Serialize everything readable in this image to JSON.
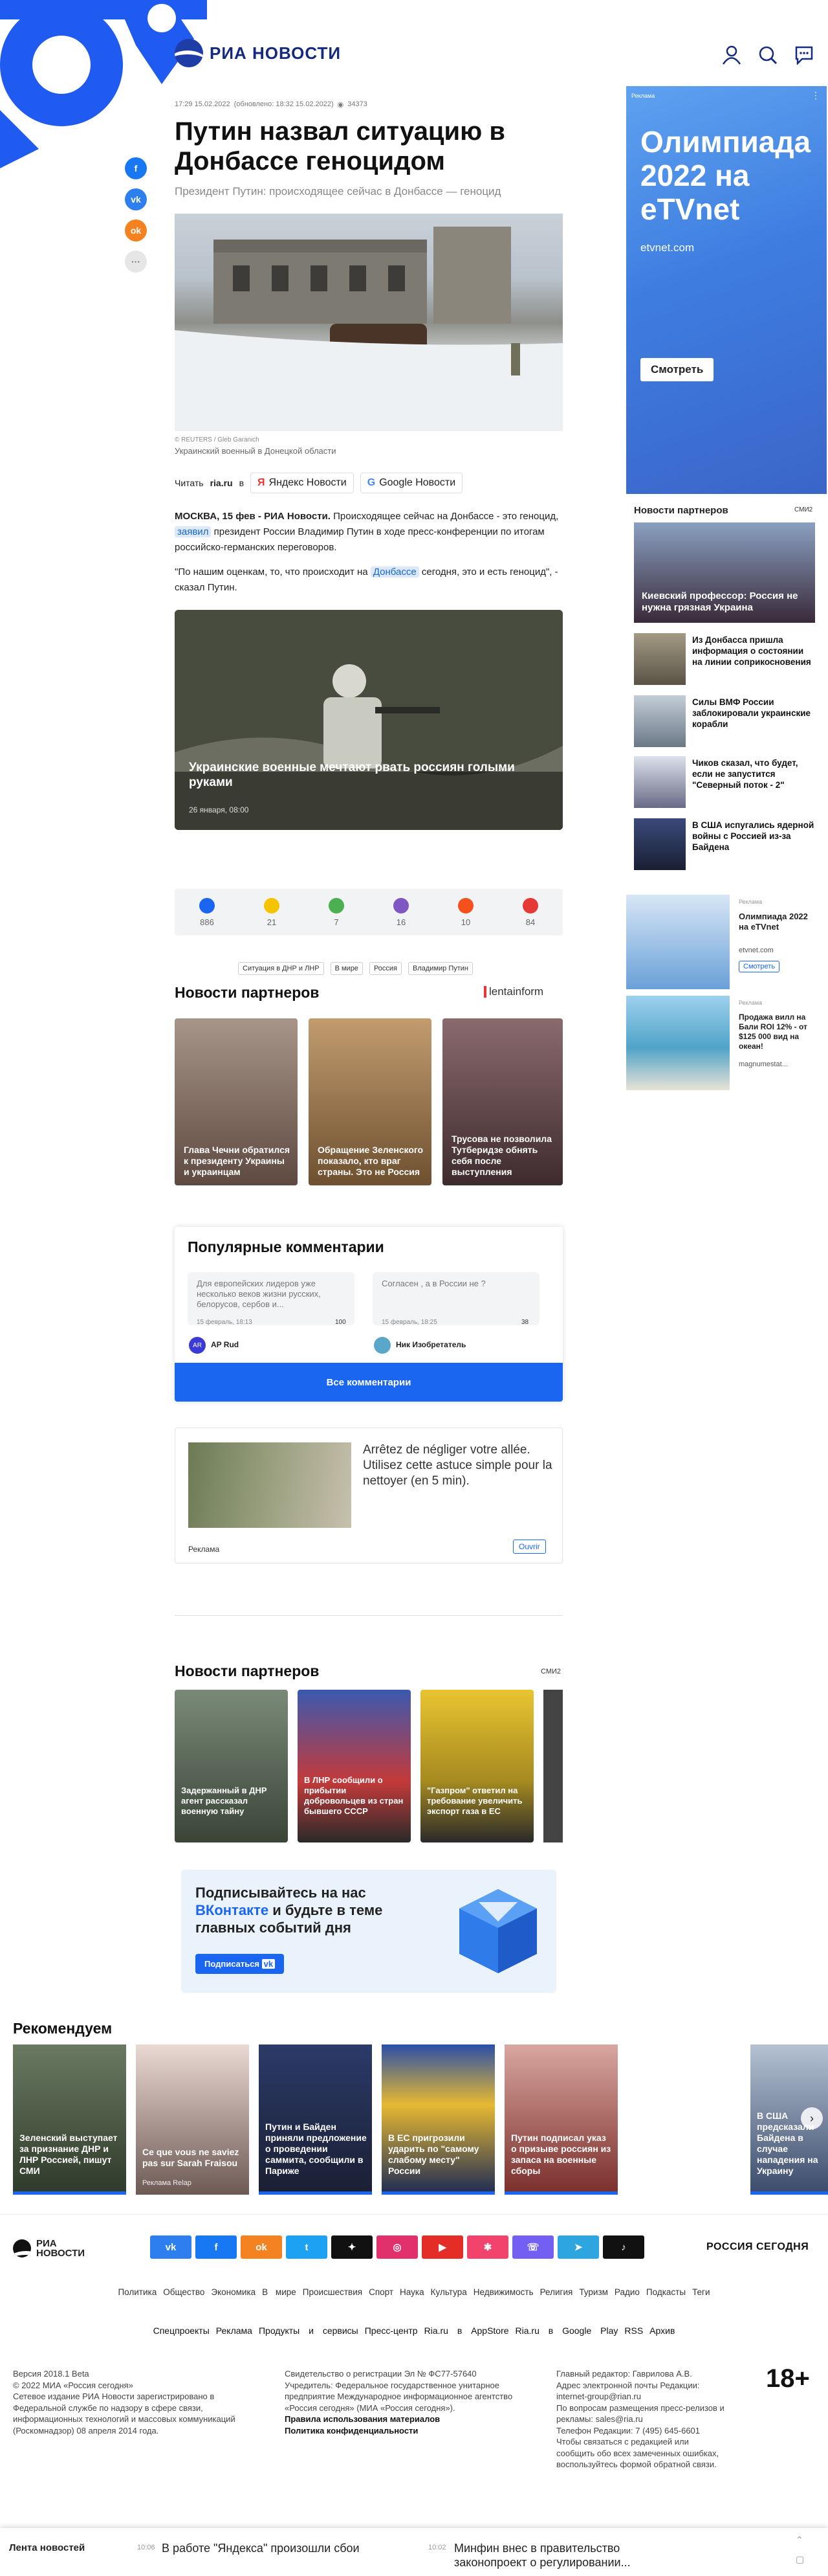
{
  "header": {
    "logo_text": "РИА НОВОСТИ"
  },
  "article": {
    "timestamp": "17:29 15.02.2022",
    "updated": "(обновлено: 18:32 15.02.2022)",
    "views": "34373",
    "title": "Путин назвал ситуацию в Донбассе геноцидом",
    "lead": "Президент Путин: происходящее сейчас в Донбассе — геноцид",
    "photo_credit": "© REUTERS / Gleb Garanich",
    "photo_caption": "Украинский военный в Донецкой области",
    "read_label": "Читать",
    "read_site": "ria.ru",
    "read_in": "в",
    "yandex_label": "Яндекс Новости",
    "google_label": "Google Новости",
    "p1_bold": "МОСКВА, 15 фев - РИА Новости.",
    "p1_a": "Происходящее сейчас на Донбассе - это геноцид,",
    "p1_link": "заявил",
    "p1_b": "президент России Владимир Путин в ходе пресс-конференции по итогам российско-германских переговоров.",
    "p2_a": "\"По нашим оценкам, то, что происходит на",
    "p2_link": "Донбассе",
    "p2_b": "сегодня, это и есть геноцид\", - сказал Путин."
  },
  "promo": {
    "title": "Украинские военные мечтают рвать россиян голыми руками",
    "date": "26 января, 08:00"
  },
  "reactions": [
    {
      "count": "886",
      "color": "#1a66f0"
    },
    {
      "count": "21",
      "color": "#f5c400"
    },
    {
      "count": "7",
      "color": "#4caf50"
    },
    {
      "count": "16",
      "color": "#7e57c2"
    },
    {
      "count": "10",
      "color": "#f4511e"
    },
    {
      "count": "84",
      "color": "#e53935"
    }
  ],
  "tags": [
    "Ситуация в ДНР и ЛНР",
    "В мире",
    "Россия",
    "Владимир Путин"
  ],
  "partners1": {
    "title": "Новости партнеров",
    "brand": "lentainform",
    "items": [
      {
        "title": "Глава Чечни обратился к президенту Украины и украинцам"
      },
      {
        "title": "Обращение Зеленского показало, кто враг страны. Это не Россия"
      },
      {
        "title": "Трусова не позволила Тутберидзе обнять себя после выступления"
      }
    ]
  },
  "comments": {
    "title": "Популярные комментарии",
    "items": [
      {
        "text": "Для европейских лидеров уже несколько веков жизни русских, белорусов, сербов и...",
        "date": "15 февраль, 18:13",
        "likes": "100",
        "user": "AP Rud"
      },
      {
        "text": "Согласен , а в России не ?",
        "date": "15 февраль, 18:25",
        "likes": "38",
        "user": "Ник Изобретатель"
      }
    ],
    "all_label": "Все комментарии"
  },
  "ad1": {
    "text": "Arrêtez de négliger votre allée. Utilisez cette astuce simple pour la nettoyer (en 5 min).",
    "label": "Реклама",
    "button": "Ouvrir"
  },
  "partners2": {
    "title": "Новости партнеров",
    "brand": "СМИ2",
    "items": [
      {
        "title": "Задержанный в ДНР агент рассказал военную тайну"
      },
      {
        "title": "В ЛНР сообщили о прибытии добровольцев из стран бывшего СССР"
      },
      {
        "title": "\"Газпром\" ответил на требование увеличить экспорт газа в ЕС"
      }
    ]
  },
  "subscribe": {
    "line1": "Подписывайтесь на нас",
    "vk": "ВКонтакте",
    "line2": "и будьте в теме главных событий дня",
    "button": "Подписаться"
  },
  "recommend": {
    "title": "Рекомендуем",
    "items": [
      {
        "title": "Зеленский выступает за признание ДНР и ЛНР Россией, пишут СМИ"
      },
      {
        "title": "Ce que vous ne saviez pas sur Sarah Fraisou",
        "sub": "Реклама Relap"
      },
      {
        "title": "Путин и Байден приняли предложение о проведении саммита, сообщили в Париже"
      },
      {
        "title": "В ЕС пригрозили ударить по \"самому слабому месту\" России"
      },
      {
        "title": "Путин подписал указ о призыве россиян из запаса на военные сборы"
      },
      {
        "title": "В США предсказали Байдена в случае нападения на Украину"
      }
    ]
  },
  "sidebar": {
    "ad": {
      "tag": "Реклама",
      "title": "Олимпиада 2022 на eTVnet",
      "url": "etvnet.com",
      "button": "Смотреть"
    },
    "partners_title": "Новости партнеров",
    "partners_brand": "СМИ2",
    "partners_top": "Киевский профессор: Россия не нужна грязная Украина",
    "partners": [
      {
        "title": "Из Донбасса пришла информация о состоянии на линии соприкосновения"
      },
      {
        "title": "Силы ВМФ России заблокировали украинские корабли"
      },
      {
        "title": "Чиков сказал, что будет, если не запустится \"Северный поток - 2\""
      },
      {
        "title": "В США испугались ядерной войны с Россией из-за Байдена"
      }
    ],
    "mini1": {
      "tag": "Реклама",
      "title": "Олимпиада 2022 на eTVnet",
      "sub": "etvnet.com",
      "button": "Смотреть"
    },
    "mini2": {
      "tag": "Реклама",
      "title": "Продажа вилл на Бали ROI 12% - от $125 000 вид на океан!",
      "sub": "magnumestat..."
    }
  },
  "footer": {
    "logo": "РИА НОВОСТИ",
    "rs": "РОССИЯ СЕГОДНЯ",
    "menu1": [
      "Политика",
      "Общество",
      "Экономика",
      "В мире",
      "Происшествия",
      "Спорт",
      "Наука",
      "Культура",
      "Недвижимость",
      "Религия",
      "Туризм",
      "Радио",
      "Подкасты",
      "Теги"
    ],
    "menu2": [
      "Спецпроекты",
      "Реклама",
      "Продукты и сервисы",
      "Пресс-центр",
      "Ria.ru в AppStore",
      "Ria.ru в Google Play",
      "RSS",
      "Архив"
    ],
    "col1": [
      "Версия 2018.1 Beta",
      "© 2022 МИА «Россия сегодня»",
      "Сетевое издание РИА Новости зарегистрировано в Федеральной службе по надзору в сфере связи, информационных технологий и массовых коммуникаций (Роскомнадзор) 08 апреля 2014 года."
    ],
    "col2": [
      "Свидетельство о регистрации Эл № ФС77-57640",
      "Учредитель: Федеральное государственное унитарное предприятие Международное информационное агентство «Россия сегодня» (МИА «Россия сегодня»).",
      "Правила использования материалов",
      "Политика конфиденциальности"
    ],
    "col3": [
      "Главный редактор: Гаврилова А.В.",
      "Адрес электронной почты Редакции: internet-group@rian.ru",
      "По вопросам размещения пресс-релизов и рекламы: sales@ria.ru",
      "Телефон Редакции: 7 (495) 645-6601",
      "Чтобы связаться с редакцией или сообщить обо всех замеченных ошибках, воспользуйтесь формой обратной связи."
    ],
    "age": "18+"
  },
  "newsbar": {
    "label": "Лента новостей",
    "items": [
      {
        "time": "10:06",
        "text": "В работе \"Яндекса\" произошли сбои"
      },
      {
        "time": "10:02",
        "text": "Минфин внес в правительство законопроект о регулировании..."
      }
    ]
  }
}
